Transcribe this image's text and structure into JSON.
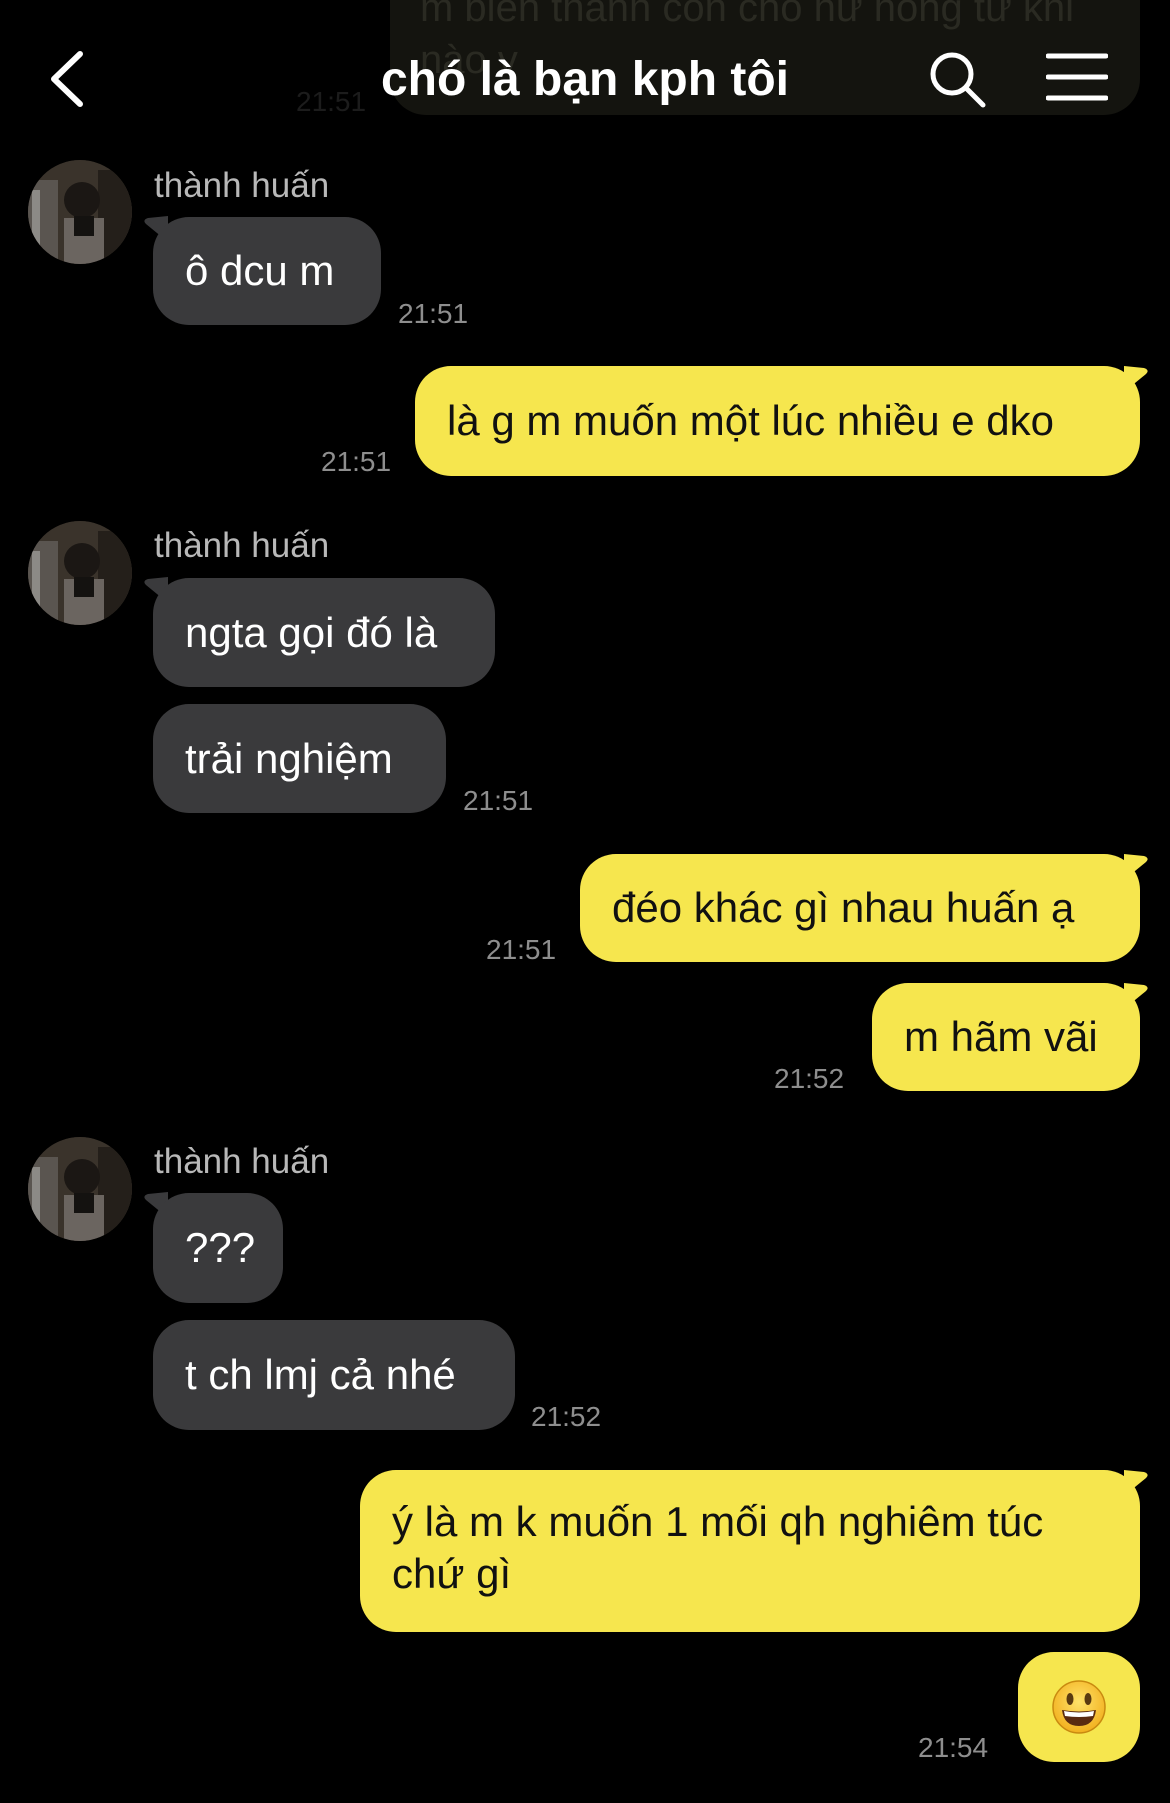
{
  "header": {
    "title": "chó là bạn kph tôi"
  },
  "ghost": {
    "text": "m biến thành con chó hư hỏng từ khi nào v",
    "time": "21:51"
  },
  "sender_name": "thành huấn",
  "messages": [
    {
      "id": "m1",
      "direction": "in",
      "text": "ô dcu m",
      "time": "21:51"
    },
    {
      "id": "m2",
      "direction": "out",
      "text": "là g m muốn một lúc nhiều e dko",
      "time": "21:51"
    },
    {
      "id": "m3",
      "direction": "in",
      "text": "ngta gọi đó là",
      "time": ""
    },
    {
      "id": "m4",
      "direction": "in",
      "text": "trải nghiệm",
      "time": "21:51"
    },
    {
      "id": "m5",
      "direction": "out",
      "text": "đéo khác gì nhau huấn ạ",
      "time": "21:51"
    },
    {
      "id": "m6",
      "direction": "out",
      "text": "m hãm vãi",
      "time": "21:52"
    },
    {
      "id": "m7",
      "direction": "in",
      "text": "???",
      "time": ""
    },
    {
      "id": "m8",
      "direction": "in",
      "text": "t ch lmj cả nhé",
      "time": "21:52"
    },
    {
      "id": "m9",
      "direction": "out",
      "text": "ý là m k muốn 1 mối qh nghiêm túc chứ gì",
      "time": ""
    },
    {
      "id": "m10",
      "direction": "out",
      "text": "",
      "emoji": "grinning-face",
      "time": "21:54"
    }
  ],
  "colors": {
    "background": "#000000",
    "incoming_bubble": "#3a3a3c",
    "outgoing_bubble": "#f6e64e",
    "timestamp": "#8e8e8e",
    "sender_name": "#b8b8b8"
  },
  "icons": [
    "chevron-left-icon",
    "search-icon",
    "menu-icon",
    "avatar",
    "grinning-face-emoji"
  ]
}
